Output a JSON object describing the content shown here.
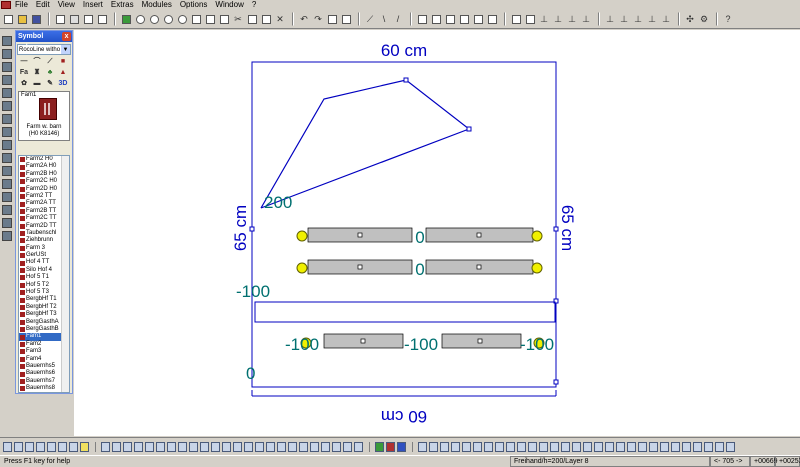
{
  "menu": [
    "File",
    "Edit",
    "View",
    "Insert",
    "Extras",
    "Modules",
    "Options",
    "Window",
    "?"
  ],
  "palette": {
    "title": "Symbol selec...",
    "close": "x",
    "library": "RocoLine witho",
    "symbol_labels": [
      "Fa",
      "3D"
    ],
    "preview_tag": "Fam1",
    "preview_name_1": "Farm w. barn",
    "preview_name_2": "(H0 K8146)",
    "items": [
      "Farm2 H0",
      "Farm2A H0",
      "Farm2B H0",
      "Farm2C H0",
      "Farm2D H0",
      "Farm2 TT",
      "Farm2A TT",
      "Farm2B TT",
      "Farm2C TT",
      "Farm2D TT",
      "Taubenschl",
      "Ziehbrunn",
      "Farm 3",
      "GerUSt",
      "Hof 4 TT",
      "Silo Hof 4",
      "Hof 5 T1",
      "Hof 5 T2",
      "Hof 5 T3",
      "BergbHf T1",
      "BergbHf T2",
      "BergbHf T3",
      "BergGasthA",
      "BergGasthB",
      "Fam1",
      "Fam2",
      "Fam3",
      "Fam4",
      "Bauernhs5",
      "Bauernhs6",
      "Bauernhs7",
      "Bauernhs8"
    ],
    "selected_index": 24
  },
  "drawing": {
    "dim_top": "60 cm",
    "dim_bottom": "60 cm",
    "dim_left": "65 cm",
    "dim_right": "65 cm",
    "height_200": "200",
    "height_0_a": "0",
    "height_0_b": "0",
    "height_neg100_a": "-100",
    "height_neg100_b": "-100",
    "height_neg100_c": "-100",
    "height_neg100_d": "-100",
    "height_0_c": "0",
    "colors": {
      "frame": "#0000c0",
      "height_label": "#007070",
      "track": "#c0c0c0",
      "signal": "#f0f000"
    }
  },
  "status": {
    "help": "Press F1 key for help",
    "mode": "Freihand/h=200/Layer 8",
    "angle": "<- 705 ->",
    "coord_x": "+00669",
    "coord_y": "+00253"
  }
}
